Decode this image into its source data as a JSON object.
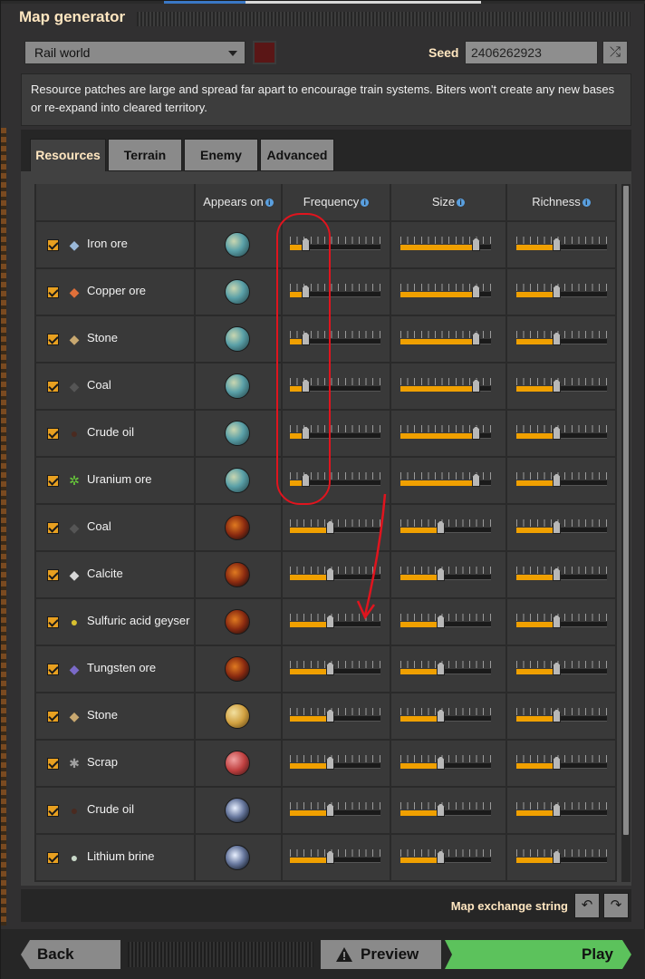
{
  "window": {
    "title": "Map generator"
  },
  "preset": {
    "selected": "Rail world"
  },
  "seed": {
    "label": "Seed",
    "value": "2406262923"
  },
  "description": "Resource patches are large and spread far apart to encourage train systems. Biters won't create any new bases or re-expand into cleared territory.",
  "tabs": [
    {
      "label": "Resources",
      "active": true
    },
    {
      "label": "Terrain",
      "active": false
    },
    {
      "label": "Enemy",
      "active": false
    },
    {
      "label": "Advanced",
      "active": false
    }
  ],
  "table": {
    "headers": {
      "appears_on": "Appears on",
      "frequency": "Frequency",
      "size": "Size",
      "richness": "Richness"
    },
    "rows": [
      {
        "name": "Iron ore",
        "icon": "iron-ore-icon",
        "planet": "nauvis",
        "frequency": 0.17,
        "size": 0.83,
        "richness": 0.44
      },
      {
        "name": "Copper ore",
        "icon": "copper-ore-icon",
        "planet": "nauvis",
        "frequency": 0.17,
        "size": 0.83,
        "richness": 0.44
      },
      {
        "name": "Stone",
        "icon": "stone-icon",
        "planet": "nauvis",
        "frequency": 0.17,
        "size": 0.83,
        "richness": 0.44
      },
      {
        "name": "Coal",
        "icon": "coal-icon",
        "planet": "nauvis",
        "frequency": 0.17,
        "size": 0.83,
        "richness": 0.44
      },
      {
        "name": "Crude oil",
        "icon": "crude-oil-icon",
        "planet": "nauvis",
        "frequency": 0.17,
        "size": 0.83,
        "richness": 0.44
      },
      {
        "name": "Uranium ore",
        "icon": "uranium-ore-icon",
        "planet": "nauvis",
        "frequency": 0.17,
        "size": 0.83,
        "richness": 0.44
      },
      {
        "name": "Coal",
        "icon": "coal-icon",
        "planet": "vulcanus",
        "frequency": 0.44,
        "size": 0.44,
        "richness": 0.44
      },
      {
        "name": "Calcite",
        "icon": "calcite-icon",
        "planet": "vulcanus",
        "frequency": 0.44,
        "size": 0.44,
        "richness": 0.44
      },
      {
        "name": "Sulfuric acid geyser",
        "icon": "sulfuric-acid-geyser-icon",
        "planet": "vulcanus",
        "frequency": 0.44,
        "size": 0.44,
        "richness": 0.44
      },
      {
        "name": "Tungsten ore",
        "icon": "tungsten-ore-icon",
        "planet": "vulcanus",
        "frequency": 0.44,
        "size": 0.44,
        "richness": 0.44
      },
      {
        "name": "Stone",
        "icon": "stone-icon",
        "planet": "fulgora",
        "frequency": 0.44,
        "size": 0.44,
        "richness": 0.44
      },
      {
        "name": "Scrap",
        "icon": "scrap-icon",
        "planet": "fulgora-red",
        "frequency": 0.44,
        "size": 0.44,
        "richness": 0.44
      },
      {
        "name": "Crude oil",
        "icon": "crude-oil-icon",
        "planet": "aquilo",
        "frequency": 0.44,
        "size": 0.44,
        "richness": 0.44
      },
      {
        "name": "Lithium brine",
        "icon": "lithium-brine-icon",
        "planet": "aquilo",
        "frequency": 0.44,
        "size": 0.44,
        "richness": 0.44
      }
    ]
  },
  "exchange": {
    "label": "Map exchange string"
  },
  "buttons": {
    "back": "Back",
    "preview": "Preview",
    "play": "Play"
  },
  "colors": {
    "accent": "#f0a000",
    "play": "#5cc25c",
    "annotation": "#e0141e"
  }
}
